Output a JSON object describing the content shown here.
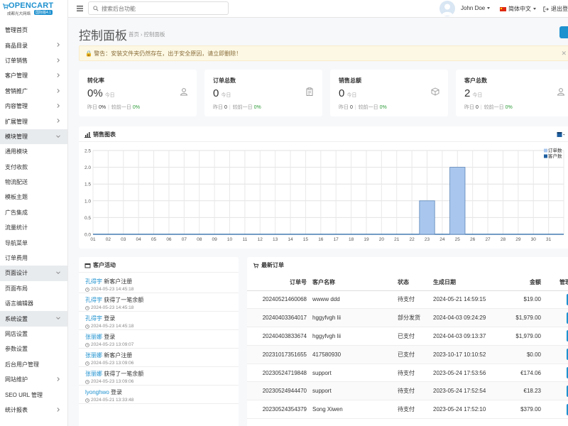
{
  "brand": {
    "name": "OPENCART",
    "subtitle": "成都光大网络",
    "badge": "国际版4.1"
  },
  "topbar": {
    "search_placeholder": "搜索后台功能",
    "user_name": "John Doe",
    "language": "简体中文",
    "logout": "退出登录"
  },
  "sidebar": {
    "items": [
      {
        "label": "管理首页",
        "kind": "top",
        "chevron": false,
        "active": false
      },
      {
        "label": "商品目录",
        "kind": "top",
        "chevron": true,
        "active": false
      },
      {
        "label": "订单销售",
        "kind": "top",
        "chevron": true,
        "active": false
      },
      {
        "label": "客户管理",
        "kind": "top",
        "chevron": true,
        "active": false
      },
      {
        "label": "营销推广",
        "kind": "top",
        "chevron": true,
        "active": false
      },
      {
        "label": "内容管理",
        "kind": "top",
        "chevron": true,
        "active": false
      },
      {
        "label": "扩展管理",
        "kind": "top",
        "chevron": true,
        "active": false
      },
      {
        "label": "模块管理",
        "kind": "top",
        "chevron": true,
        "active": true,
        "open": true
      },
      {
        "label": "通用模块",
        "kind": "sub"
      },
      {
        "label": "支付收款",
        "kind": "sub"
      },
      {
        "label": "物流配送",
        "kind": "sub"
      },
      {
        "label": "模板主题",
        "kind": "sub"
      },
      {
        "label": "广告集成",
        "kind": "sub"
      },
      {
        "label": "流量统计",
        "kind": "sub"
      },
      {
        "label": "导航菜单",
        "kind": "sub"
      },
      {
        "label": "订单费用",
        "kind": "sub"
      },
      {
        "label": "页面设计",
        "kind": "top",
        "chevron": true,
        "active": true,
        "open": true
      },
      {
        "label": "页面布局",
        "kind": "sub"
      },
      {
        "label": "语言编辑器",
        "kind": "sub"
      },
      {
        "label": "系统设置",
        "kind": "top",
        "chevron": true,
        "active": true,
        "open": true
      },
      {
        "label": "网店设置",
        "kind": "sub"
      },
      {
        "label": "参数设置",
        "kind": "sub"
      },
      {
        "label": "后台用户管理",
        "kind": "sub"
      },
      {
        "label": "网站维护",
        "kind": "sub",
        "chevron": true
      },
      {
        "label": "SEO URL 管理",
        "kind": "sub"
      },
      {
        "label": "统计报表",
        "kind": "top",
        "chevron": true,
        "active": false
      }
    ]
  },
  "header": {
    "title": "控制面板",
    "breadcrumb": [
      "首页",
      "控制面板"
    ]
  },
  "alert": {
    "text": "警告：安装文件夹仍然存在，出于安全原因，请立即删除！"
  },
  "stats": [
    {
      "title": "转化率",
      "value": "0%",
      "today": "今日",
      "yesterday_label": "昨日",
      "yesterday": "0%",
      "compare_label": "较前一日",
      "compare": "0%",
      "icon": "user-icon"
    },
    {
      "title": "订单总数",
      "value": "0",
      "today": "今日",
      "yesterday_label": "昨日",
      "yesterday": "0",
      "compare_label": "较前一日",
      "compare": "0%",
      "icon": "clipboard-icon"
    },
    {
      "title": "销售总额",
      "value": "0",
      "today": "今日",
      "yesterday_label": "昨日",
      "yesterday": "0",
      "compare_label": "较前一日",
      "compare": "0%",
      "icon": "cube-icon"
    },
    {
      "title": "客户总数",
      "value": "2",
      "today": "今日",
      "yesterday_label": "昨日",
      "yesterday": "0",
      "compare_label": "较前一日",
      "compare": "0%",
      "icon": "user-icon"
    }
  ],
  "chart_panel": {
    "title": "销售图表"
  },
  "chart_data": {
    "type": "bar",
    "categories": [
      "01",
      "02",
      "03",
      "04",
      "05",
      "06",
      "07",
      "08",
      "09",
      "10",
      "11",
      "12",
      "13",
      "14",
      "15",
      "16",
      "17",
      "18",
      "19",
      "20",
      "21",
      "22",
      "23",
      "24",
      "25",
      "26",
      "27",
      "28",
      "29",
      "30",
      "31"
    ],
    "series": [
      {
        "name": "订单数",
        "color": "#a9c7ee",
        "values": [
          0,
          0,
          0,
          0,
          0,
          0,
          0,
          0,
          0,
          0,
          0,
          0,
          0,
          0,
          0,
          0,
          0,
          0,
          0,
          0,
          0,
          1,
          0,
          2,
          0,
          0,
          0,
          0,
          0,
          0,
          0
        ]
      },
      {
        "name": "客户数",
        "color": "#1e5fa0",
        "values": [
          0,
          0,
          0,
          0,
          0,
          0,
          0,
          0,
          0,
          0,
          0,
          0,
          0,
          0,
          0,
          0,
          0,
          0,
          0,
          0,
          0,
          0,
          0,
          0,
          0,
          0,
          0,
          0,
          0,
          0,
          0
        ]
      }
    ],
    "yticks": [
      "0.0",
      "0.5",
      "1.0",
      "1.5",
      "2.0",
      "2.5"
    ],
    "ylim": [
      0,
      2.5
    ],
    "grid": true,
    "legend": "top-right"
  },
  "activity": {
    "title": "客户活动",
    "items": [
      {
        "who": "孔得宇",
        "action": "新客户注册",
        "time": "2024-05-23 14:45:18"
      },
      {
        "who": "孔得宇",
        "action": "获得了一笔余额",
        "time": "2024-05-23 14:45:18"
      },
      {
        "who": "孔得宇",
        "action": "登录",
        "time": "2024-05-23 14:45:18"
      },
      {
        "who": "张丽娜",
        "action": "登录",
        "time": "2024-05-23 13:09:07"
      },
      {
        "who": "张丽娜",
        "action": "新客户注册",
        "time": "2024-05-23 13:09:06"
      },
      {
        "who": "张丽娜",
        "action": "获得了一笔余额",
        "time": "2024-05-23 13:09:06"
      },
      {
        "who": "lyonghwo",
        "action": "登录",
        "time": "2024-05-21 13:33:48"
      }
    ]
  },
  "orders": {
    "title": "最新订单",
    "columns": [
      "订单号",
      "客户名称",
      "状态",
      "生成日期",
      "金额",
      "管理"
    ],
    "rows": [
      {
        "id": "20240521460068",
        "customer": "wwww ddd",
        "status": "待支付",
        "date": "2024-05-21 14:59:15",
        "total": "$19.00"
      },
      {
        "id": "20240403364017",
        "customer": "hggyfvgh lii",
        "status": "部分发货",
        "date": "2024-04-03 09:24:29",
        "total": "$1,979.00"
      },
      {
        "id": "20240403833674",
        "customer": "hggyfvgh lii",
        "status": "已支付",
        "date": "2024-04-03 09:13:37",
        "total": "$1,979.00"
      },
      {
        "id": "20231017351655",
        "customer": "417580930",
        "status": "已支付",
        "date": "2023-10-17 10:10:52",
        "total": "$0.00"
      },
      {
        "id": "20230524719848",
        "customer": "support",
        "status": "待支付",
        "date": "2023-05-24 17:53:56",
        "total": "€174.06"
      },
      {
        "id": "20230524944470",
        "customer": "support",
        "status": "待支付",
        "date": "2023-05-24 17:52:54",
        "total": "€18.23"
      },
      {
        "id": "20230524354379",
        "customer": "Song Xiwen",
        "status": "待支付",
        "date": "2023-05-24 17:52:10",
        "total": "$379.00"
      }
    ]
  }
}
